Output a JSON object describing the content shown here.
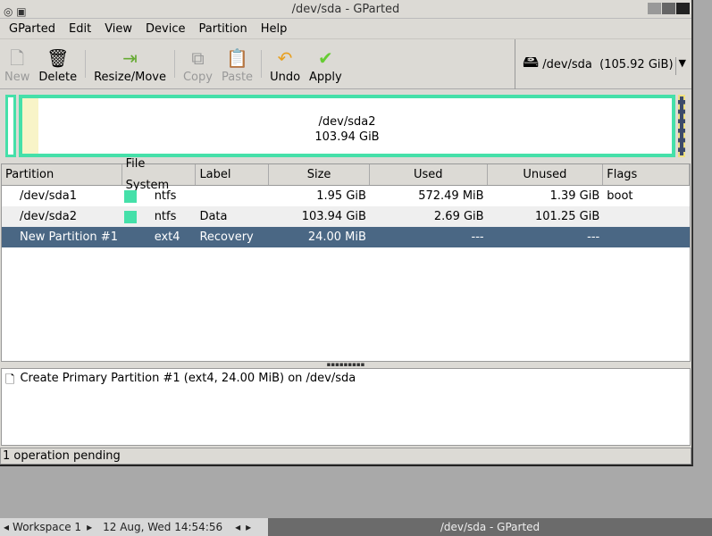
{
  "window": {
    "title": "/dev/sda - GParted"
  },
  "menu": [
    "GParted",
    "Edit",
    "View",
    "Device",
    "Partition",
    "Help"
  ],
  "toolbar": {
    "new": "New",
    "delete": "Delete",
    "resize": "Resize/Move",
    "copy": "Copy",
    "paste": "Paste",
    "undo": "Undo",
    "apply": "Apply"
  },
  "device": {
    "label": "/dev/sda  (105.92 GiB)"
  },
  "diskmap": {
    "name": "/dev/sda2",
    "size": "103.94 GiB"
  },
  "table": {
    "headers": [
      "Partition",
      "File System",
      "Label",
      "Size",
      "Used",
      "Unused",
      "Flags"
    ],
    "rows": [
      {
        "partition": "/dev/sda1",
        "fs": "ntfs",
        "label": "",
        "size": "1.95 GiB",
        "used": "572.49 MiB",
        "unused": "1.39 GiB",
        "flags": "boot"
      },
      {
        "partition": "/dev/sda2",
        "fs": "ntfs",
        "label": "Data",
        "size": "103.94 GiB",
        "used": "2.69 GiB",
        "unused": "101.25 GiB",
        "flags": ""
      },
      {
        "partition": "New Partition #1",
        "fs": "ext4",
        "label": "Recovery",
        "size": "24.00 MiB",
        "used": "---",
        "unused": "---",
        "flags": ""
      }
    ]
  },
  "operations": [
    "Create Primary Partition #1 (ext4, 24.00 MiB) on /dev/sda"
  ],
  "status": "1 operation pending",
  "taskbar": {
    "workspace": "Workspace 1",
    "clock": "12 Aug, Wed 14:54:56",
    "task": "/dev/sda - GParted"
  },
  "colors": {
    "ntfs": "#45e0a9",
    "selection": "#4a6784"
  }
}
